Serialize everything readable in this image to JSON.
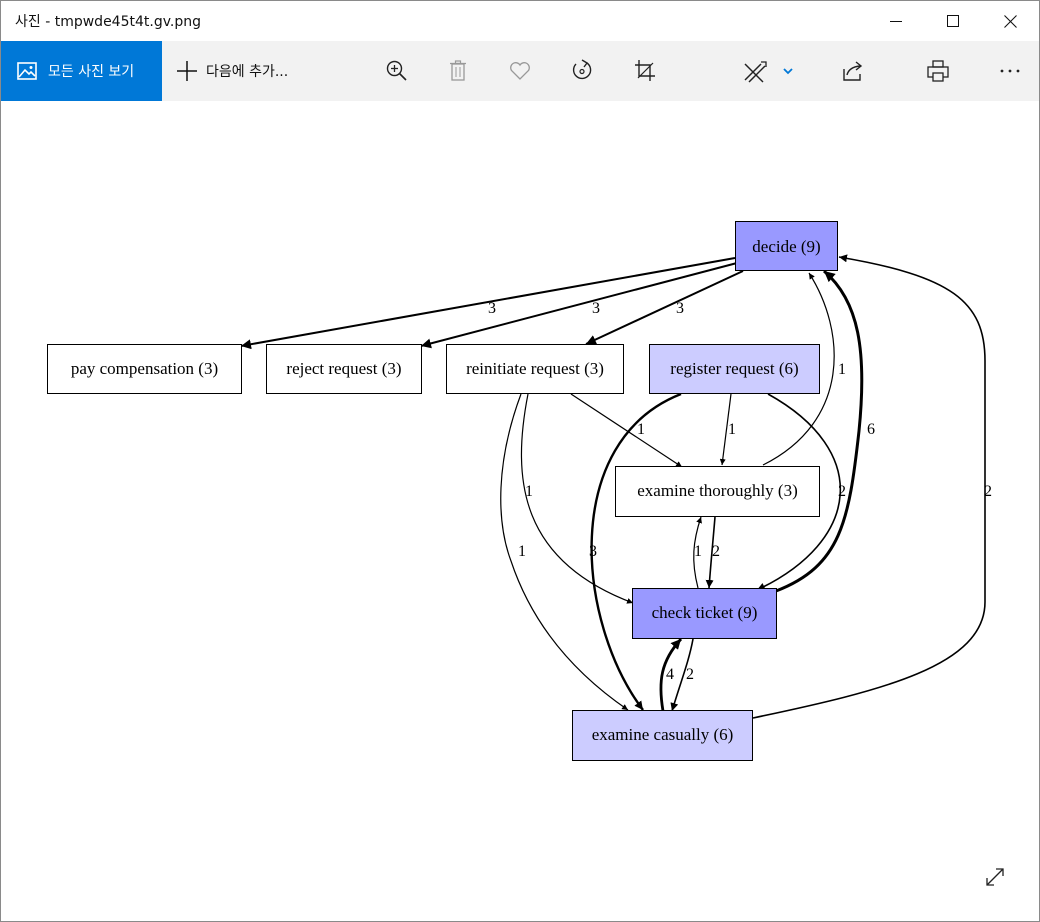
{
  "window": {
    "title": "사진 - tmpwde45t4t.gv.png",
    "controls": [
      "minimize",
      "maximize",
      "close"
    ]
  },
  "toolbar": {
    "all_photos_label": "모든 사진 보기",
    "add_to_label": "다음에 추가...",
    "icons": [
      "zoom-in-icon",
      "delete-icon",
      "favorite-icon",
      "rotate-icon",
      "crop-icon",
      "edit-icon",
      "share-icon",
      "print-icon",
      "more-icon"
    ],
    "accent": "#0078d7"
  },
  "graph": {
    "colors": {
      "high_frequency_fill": "#9999ff",
      "medium_frequency_fill": "#ccccff",
      "default_fill": "#ffffff"
    },
    "nodes": {
      "decide": "decide (9)",
      "pay_compensation": "pay compensation (3)",
      "reject_request": "reject request (3)",
      "reinitiate_request": "reinitiate request (3)",
      "register_request": "register request (6)",
      "examine_thoroughly": "examine thoroughly (3)",
      "check_ticket": "check ticket (9)",
      "examine_casually": "examine casually (6)"
    },
    "edges": {
      "decide_to_pay": "3",
      "decide_to_reject": "3",
      "decide_to_reinitiate": "3",
      "thoroughly_to_decide": "1",
      "check_to_decide": "6",
      "casually_to_decide": "2",
      "reinit_to_thoroughly": "1",
      "register_to_thoroughly": "1",
      "register_to_check": "2",
      "reinit_to_check": "1",
      "reinit_to_casually": "1",
      "register_to_casually": "3",
      "check_to_thoroughly": "1",
      "thoroughly_to_check": "2",
      "casually_to_check": "4",
      "check_to_casually": "2"
    }
  }
}
